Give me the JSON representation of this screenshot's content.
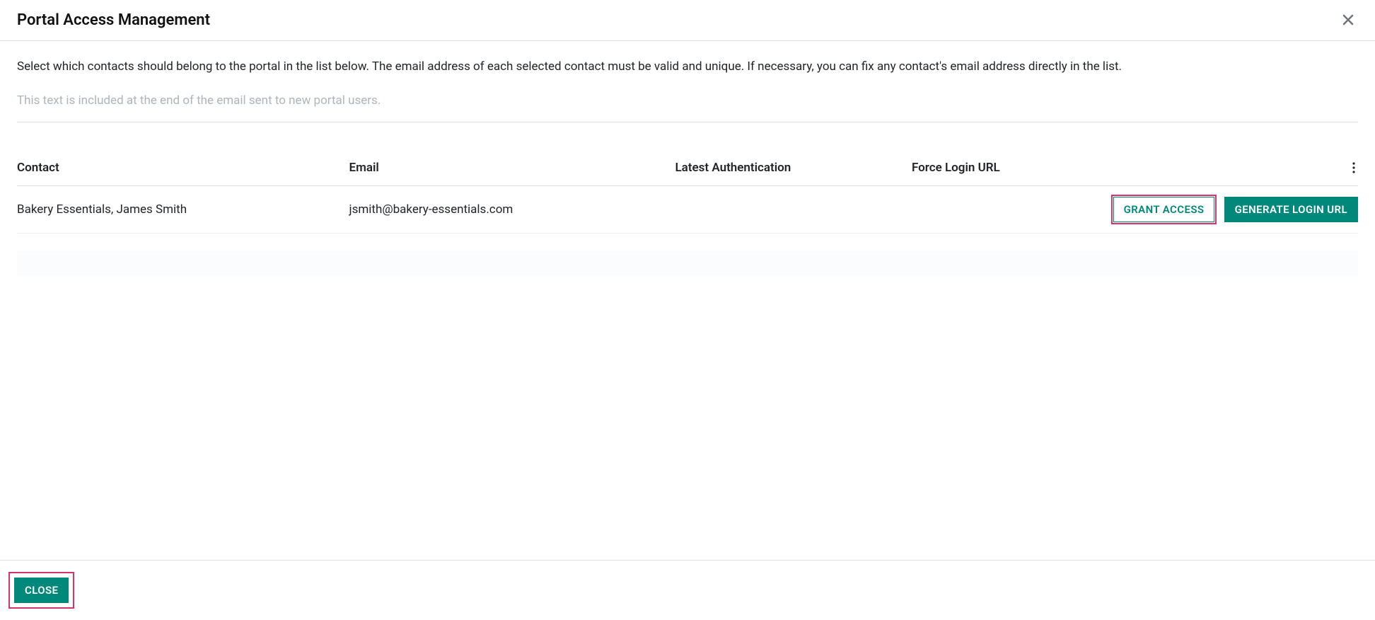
{
  "modal": {
    "title": "Portal Access Management",
    "description": "Select which contacts should belong to the portal in the list below. The email address of each selected contact must be valid and unique. If necessary, you can fix any contact's email address directly in the list.",
    "email_placeholder": "This text is included at the end of the email sent to new portal users."
  },
  "table": {
    "headers": {
      "contact": "Contact",
      "email": "Email",
      "latest_auth": "Latest Authentication",
      "force_login": "Force Login URL"
    },
    "rows": [
      {
        "contact": "Bakery Essentials, James Smith",
        "email": "jsmith@bakery-essentials.com",
        "latest_auth": "",
        "force_login": ""
      }
    ],
    "actions": {
      "grant": "Grant Access",
      "generate": "Generate Login URL"
    }
  },
  "footer": {
    "close": "Close"
  }
}
